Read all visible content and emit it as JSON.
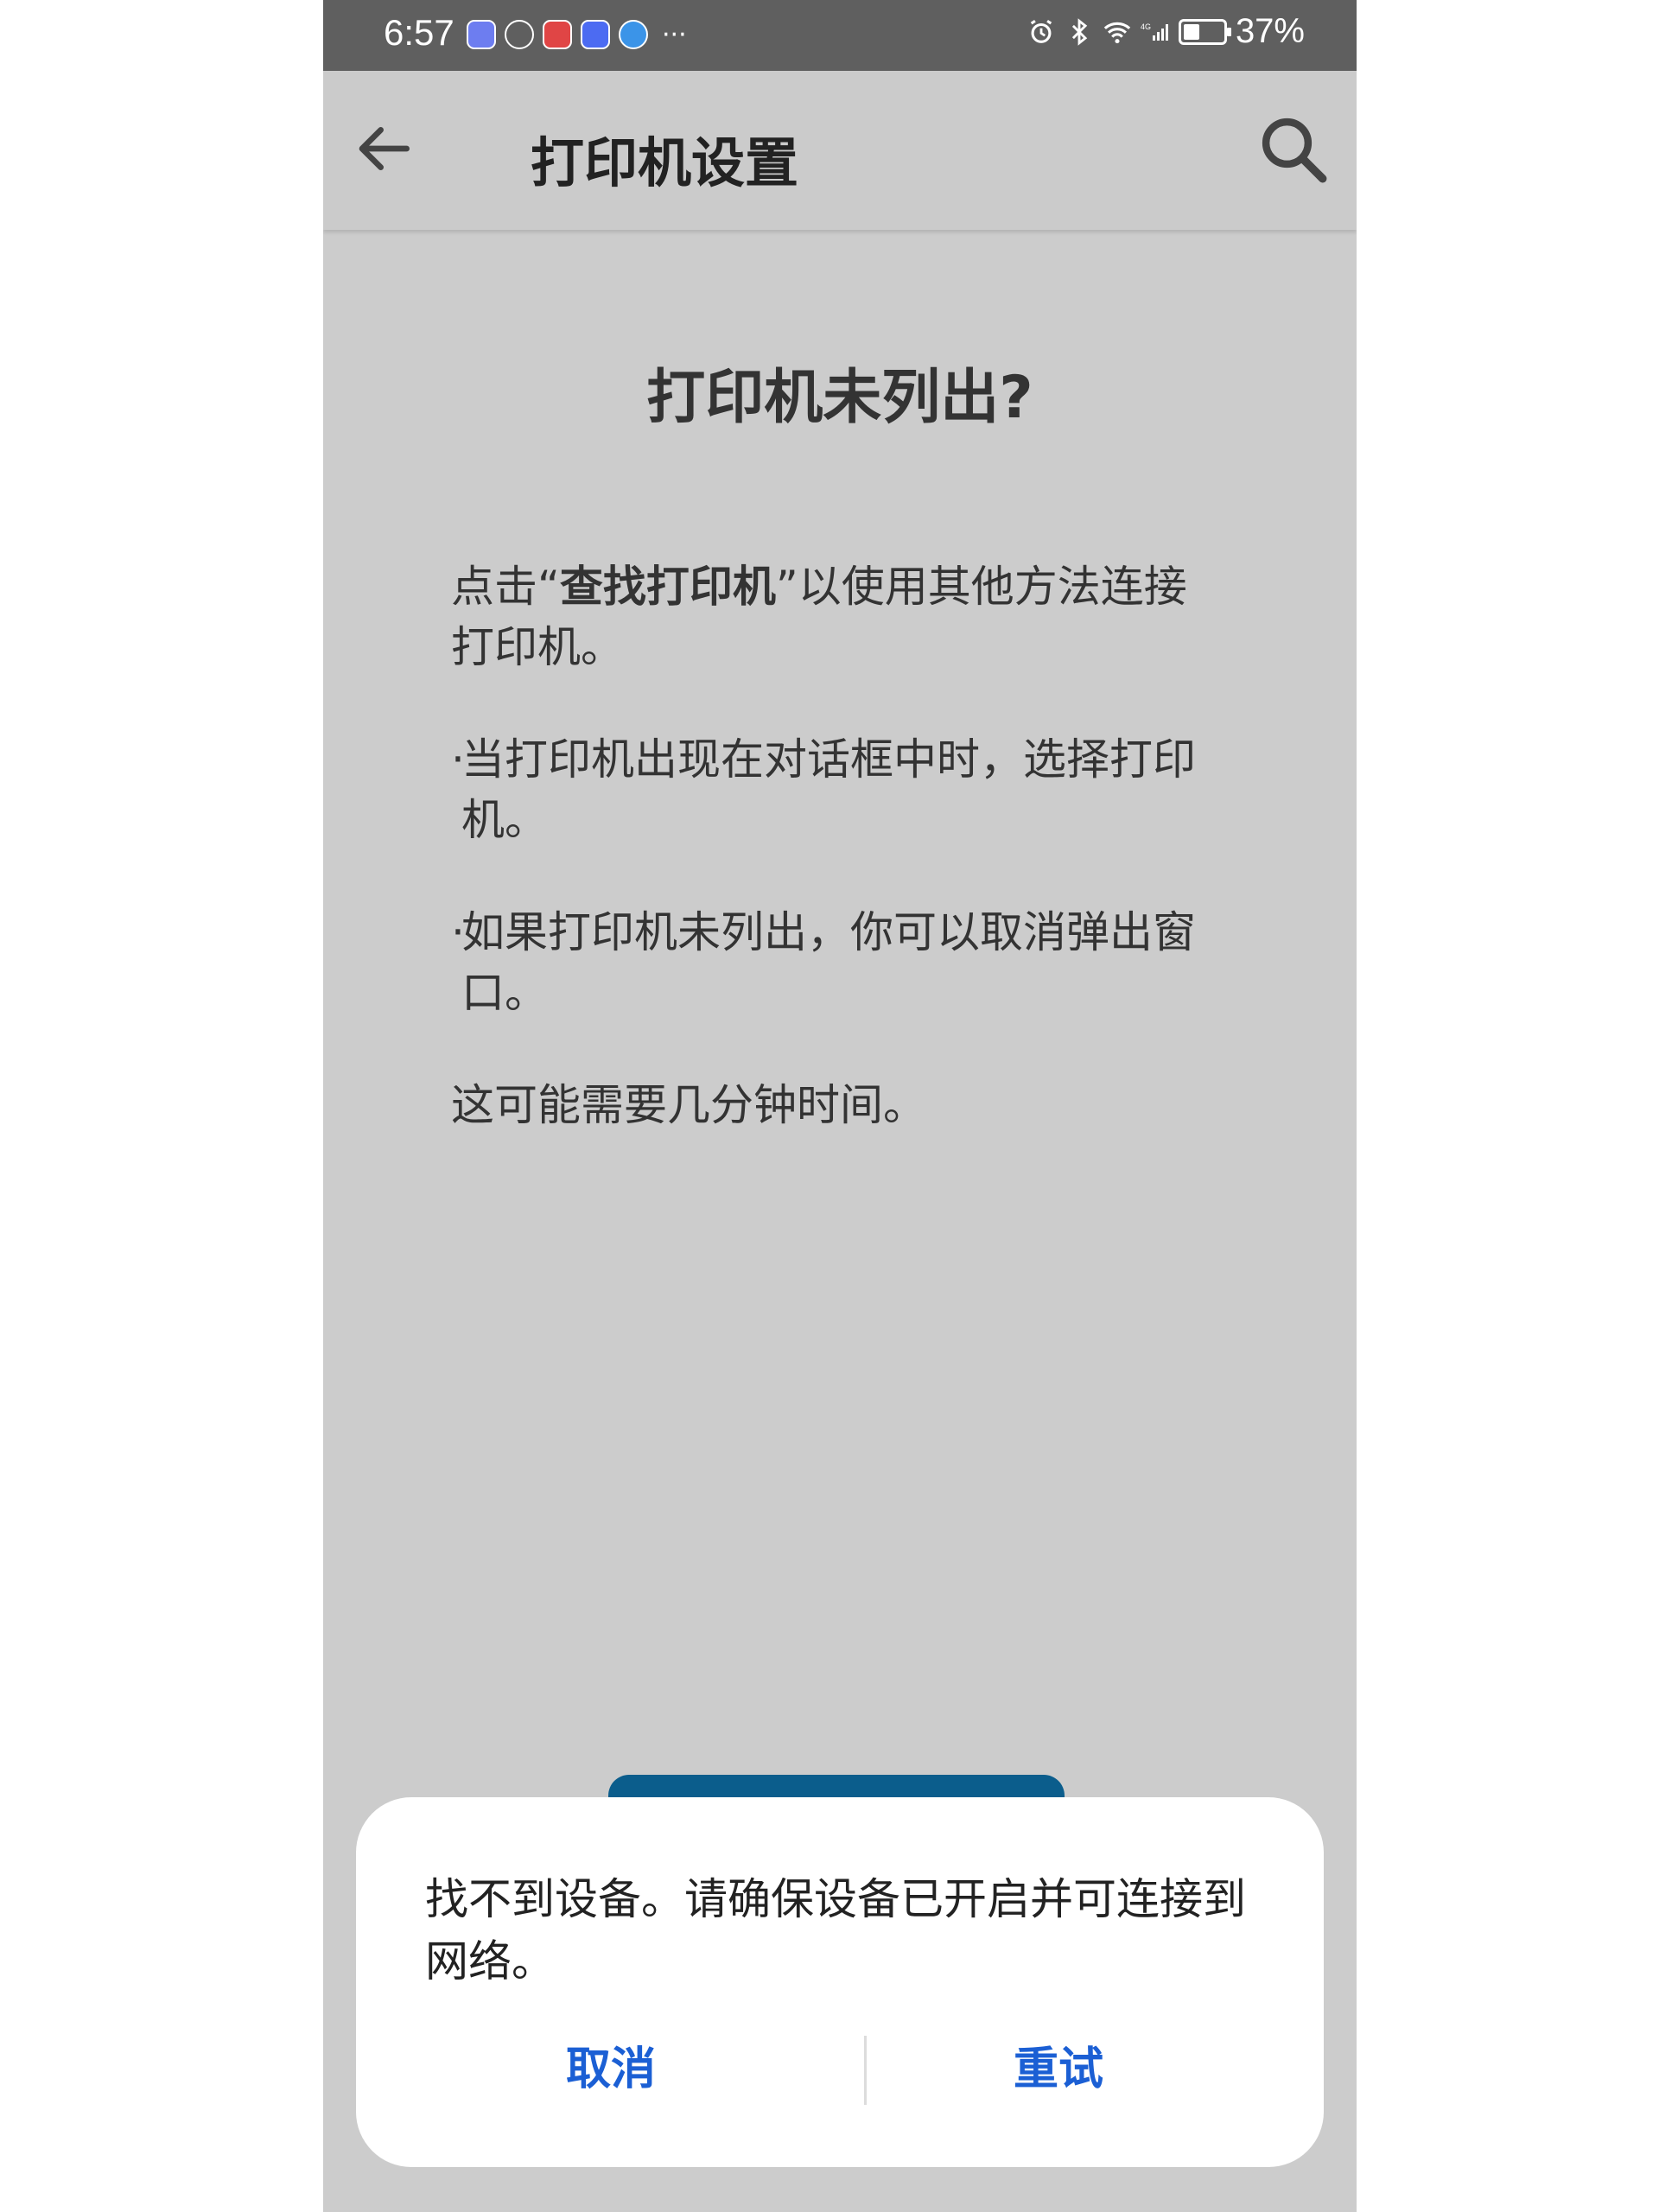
{
  "status_bar": {
    "time": "6:57",
    "more": "···",
    "network": "4G",
    "battery": "37%"
  },
  "app_bar": {
    "title": "打印机设置"
  },
  "content": {
    "heading": "打印机未列出?",
    "p1_prefix": "点击“",
    "p1_bold": "查找打印机",
    "p1_suffix": "”以使用其他方法连接打印机。",
    "bullet1": "当打印机出现在对话框中时，选择打印机。",
    "bullet2": "如果打印机未列出，你可以取消弹出窗口。",
    "p4": "这可能需要几分钟时间。",
    "bullet_char": "·"
  },
  "dialog": {
    "message": "找不到设备。请确保设备已开启并可连接到网络。",
    "cancel_label": "取消",
    "retry_label": "重试"
  },
  "colors": {
    "accent": "#1b5fd4",
    "primary_button": "#0b5d8c",
    "status_bar": "#5f5f5f",
    "scrim_background": "#cccccc"
  }
}
